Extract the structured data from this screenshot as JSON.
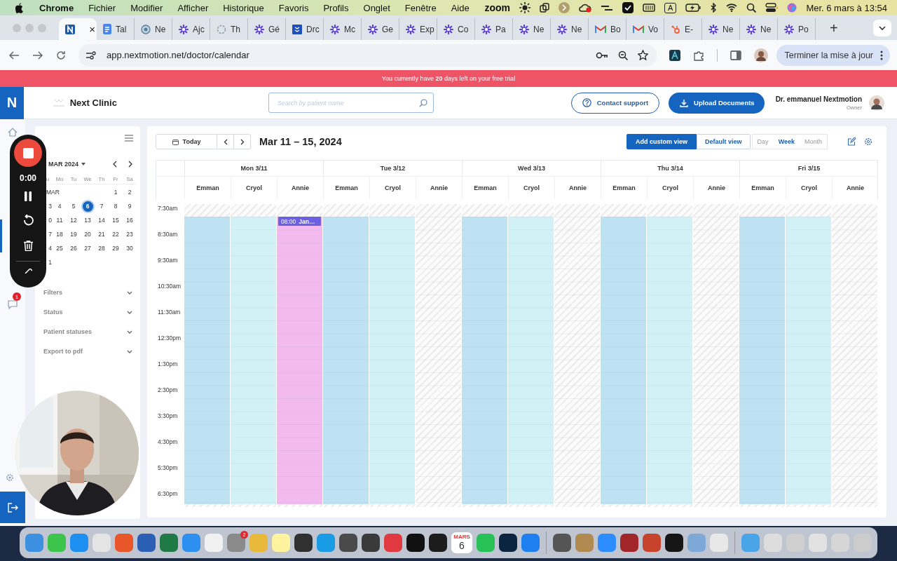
{
  "menubar": {
    "app": "Chrome",
    "items": [
      "Fichier",
      "Modifier",
      "Afficher",
      "Historique",
      "Favoris",
      "Profils",
      "Onglet",
      "Fenêtre",
      "Aide"
    ],
    "status_text": "zoom",
    "input_source": "A",
    "clock": "Mer. 6 mars à 13:54"
  },
  "tabs": [
    {
      "selected": true,
      "close": "×"
    },
    {
      "label": "Tal",
      "selected": false
    },
    {
      "label": "Ne",
      "selected": false
    },
    {
      "label": "Ajc",
      "selected": false
    },
    {
      "label": "Th",
      "selected": false
    },
    {
      "label": "Gé",
      "selected": false
    },
    {
      "label": "Drc",
      "selected": false
    },
    {
      "label": "Mc",
      "selected": false
    },
    {
      "label": "Ge",
      "selected": false
    },
    {
      "label": "Exp",
      "selected": false
    },
    {
      "label": "Co",
      "selected": false
    },
    {
      "label": "Pa",
      "selected": false
    },
    {
      "label": "Ne",
      "selected": false
    },
    {
      "label": "Ne",
      "selected": false
    },
    {
      "label": "Bo",
      "selected": false
    },
    {
      "label": "Vo",
      "selected": false
    },
    {
      "label": "E-",
      "selected": false
    },
    {
      "label": "Ne",
      "selected": false
    },
    {
      "label": "Ne",
      "selected": false
    },
    {
      "label": "Po",
      "selected": false
    }
  ],
  "new_tab": "+",
  "toolbar": {
    "url": "app.nextmotion.net/doctor/calendar",
    "update_button": "Terminer la mise à jour"
  },
  "banner": {
    "text": "You currently have **20** days left on your free trial"
  },
  "header": {
    "logo": "N",
    "clinic": "Next Clinic",
    "search_placeholder": "Search by patient name",
    "contact": "Contact support",
    "upload": "Upload Documents",
    "user": "Dr. emmanuel Nextmotion",
    "role": "Owner"
  },
  "nav": {
    "badge": "1"
  },
  "recorder": {
    "time": "0:00"
  },
  "sidebar": {
    "month": "MAR 2024",
    "weekdays": [
      "u",
      "Mo",
      "Tu",
      "We",
      "Th",
      "Fr",
      "Sa"
    ],
    "weeks": [
      {
        "label": "MAR",
        "days": [
          {
            "day": "1",
            "selected": false
          },
          {
            "day": "2",
            "selected": false
          }
        ]
      },
      {
        "days": [
          {
            "day": "3",
            "selected": false
          },
          {
            "day": "4",
            "selected": false
          },
          {
            "day": "5",
            "selected": false
          },
          {
            "day": "6",
            "selected": true
          },
          {
            "day": "7",
            "selected": false
          },
          {
            "day": "8",
            "selected": false
          },
          {
            "day": "9",
            "selected": false
          }
        ]
      },
      {
        "days": [
          {
            "day": "0",
            "selected": false
          },
          {
            "day": "11",
            "selected": false
          },
          {
            "day": "12",
            "selected": false
          },
          {
            "day": "13",
            "selected": false
          },
          {
            "day": "14",
            "selected": false
          },
          {
            "day": "15",
            "selected": false
          },
          {
            "day": "16",
            "selected": false
          }
        ]
      },
      {
        "days": [
          {
            "day": "7",
            "selected": false
          },
          {
            "day": "18",
            "selected": false
          },
          {
            "day": "19",
            "selected": false
          },
          {
            "day": "20",
            "selected": false
          },
          {
            "day": "21",
            "selected": false
          },
          {
            "day": "22",
            "selected": false
          },
          {
            "day": "23",
            "selected": false
          }
        ]
      },
      {
        "days": [
          {
            "day": "4",
            "selected": false
          },
          {
            "day": "25",
            "selected": false
          },
          {
            "day": "26",
            "selected": false
          },
          {
            "day": "27",
            "selected": false
          },
          {
            "day": "28",
            "selected": false
          },
          {
            "day": "29",
            "selected": false
          },
          {
            "day": "30",
            "selected": false
          }
        ]
      },
      {
        "days": [
          {
            "day": "1",
            "selected": false
          }
        ]
      }
    ],
    "sections": [
      "Filters",
      "Status",
      "Patient statuses",
      "Export to pdf"
    ]
  },
  "calendar": {
    "today": "Today",
    "title": "Mar 11 – 15, 2024",
    "add_view": "Add custom view",
    "default_view": "Default view",
    "views": [
      {
        "label": "Day",
        "selected": false
      },
      {
        "label": "Week",
        "selected": true
      },
      {
        "label": "Month",
        "selected": false
      }
    ],
    "days": [
      {
        "label": "Mon 3/11",
        "resources": [
          {
            "name": "Emman",
            "color": "#bfe2f2"
          },
          {
            "name": "Cryol",
            "color": "#d2f1f7"
          },
          {
            "name": "Annie",
            "color": "#f3baf0",
            "events": [
              {
                "time": "08:00",
                "title": "Jan…"
              }
            ]
          }
        ]
      },
      {
        "label": "Tue 3/12",
        "resources": [
          {
            "name": "Emman",
            "color": "#bfe2f2"
          },
          {
            "name": "Cryol",
            "color": "#d2f1f7"
          },
          {
            "name": "Annie"
          }
        ]
      },
      {
        "label": "Wed 3/13",
        "resources": [
          {
            "name": "Emman",
            "color": "#bfe2f2"
          },
          {
            "name": "Cryol",
            "color": "#d2f1f7"
          },
          {
            "name": "Annie"
          }
        ]
      },
      {
        "label": "Thu 3/14",
        "resources": [
          {
            "name": "Emman",
            "color": "#bfe2f2"
          },
          {
            "name": "Cryol",
            "color": "#d2f1f7"
          },
          {
            "name": "Annie"
          }
        ]
      },
      {
        "label": "Fri 3/15",
        "resources": [
          {
            "name": "Emman",
            "color": "#bfe2f2"
          },
          {
            "name": "Cryol",
            "color": "#d2f1f7"
          },
          {
            "name": "Annie"
          }
        ]
      }
    ],
    "times": [
      "7:30am",
      "8:30am",
      "9:30am",
      "10:30am",
      "11:30am",
      "12:30pm",
      "1:30pm",
      "2:30pm",
      "3:30pm",
      "4:30pm",
      "5:30pm",
      "6:30pm"
    ]
  },
  "dock": {
    "apps": [
      {
        "kind": "app",
        "color": "#3d8fe0"
      },
      {
        "kind": "app",
        "color": "#3cc54a"
      },
      {
        "kind": "app",
        "color": "#1d8ff0"
      },
      {
        "kind": "app",
        "color": "#e4e4e4"
      },
      {
        "kind": "app",
        "color": "#e8562a"
      },
      {
        "kind": "app",
        "color": "#2b5fb4"
      },
      {
        "kind": "app",
        "color": "#1f7a45"
      },
      {
        "kind": "app",
        "color": "#2d8ff0"
      },
      {
        "kind": "app",
        "color": "#f1f1f1"
      },
      {
        "kind": "app",
        "color": "#8a8a8a",
        "badge": "2"
      },
      {
        "kind": "app",
        "color": "#e9b93a"
      },
      {
        "kind": "app",
        "color": "#fff3a0"
      },
      {
        "kind": "app",
        "color": "#303030"
      },
      {
        "kind": "app",
        "color": "#1a9be6"
      },
      {
        "kind": "app",
        "color": "#4a4a4a"
      },
      {
        "kind": "app",
        "color": "#3a3a3a"
      },
      {
        "kind": "app",
        "color": "#e03a40"
      },
      {
        "kind": "app",
        "color": "#111111"
      },
      {
        "kind": "app",
        "color": "#1c1c1c"
      },
      {
        "kind": "calendar",
        "month": "MARS",
        "day": "6"
      },
      {
        "kind": "app",
        "color": "#27c257"
      },
      {
        "kind": "app",
        "color": "#0b2440"
      },
      {
        "kind": "app",
        "color": "#1d7ff0"
      },
      {
        "kind": "separator"
      },
      {
        "kind": "app",
        "color": "#555555"
      },
      {
        "kind": "app",
        "color": "#b08a50"
      },
      {
        "kind": "app",
        "color": "#2d8cff"
      },
      {
        "kind": "app",
        "color": "#a0262a"
      },
      {
        "kind": "app",
        "color": "#c8432b"
      },
      {
        "kind": "app",
        "color": "#151515"
      },
      {
        "kind": "app",
        "color": "#7ea8d8"
      },
      {
        "kind": "app",
        "color": "#e8e8e8"
      },
      {
        "kind": "separator"
      },
      {
        "kind": "app",
        "color": "#4aa5e8"
      },
      {
        "kind": "app",
        "color": "#dddddd"
      },
      {
        "kind": "app",
        "color": "#cfcfcf"
      },
      {
        "kind": "app",
        "color": "#e2e2e2"
      },
      {
        "kind": "app",
        "color": "#d6d6d6"
      },
      {
        "kind": "app",
        "color": "#cccccc"
      }
    ]
  }
}
